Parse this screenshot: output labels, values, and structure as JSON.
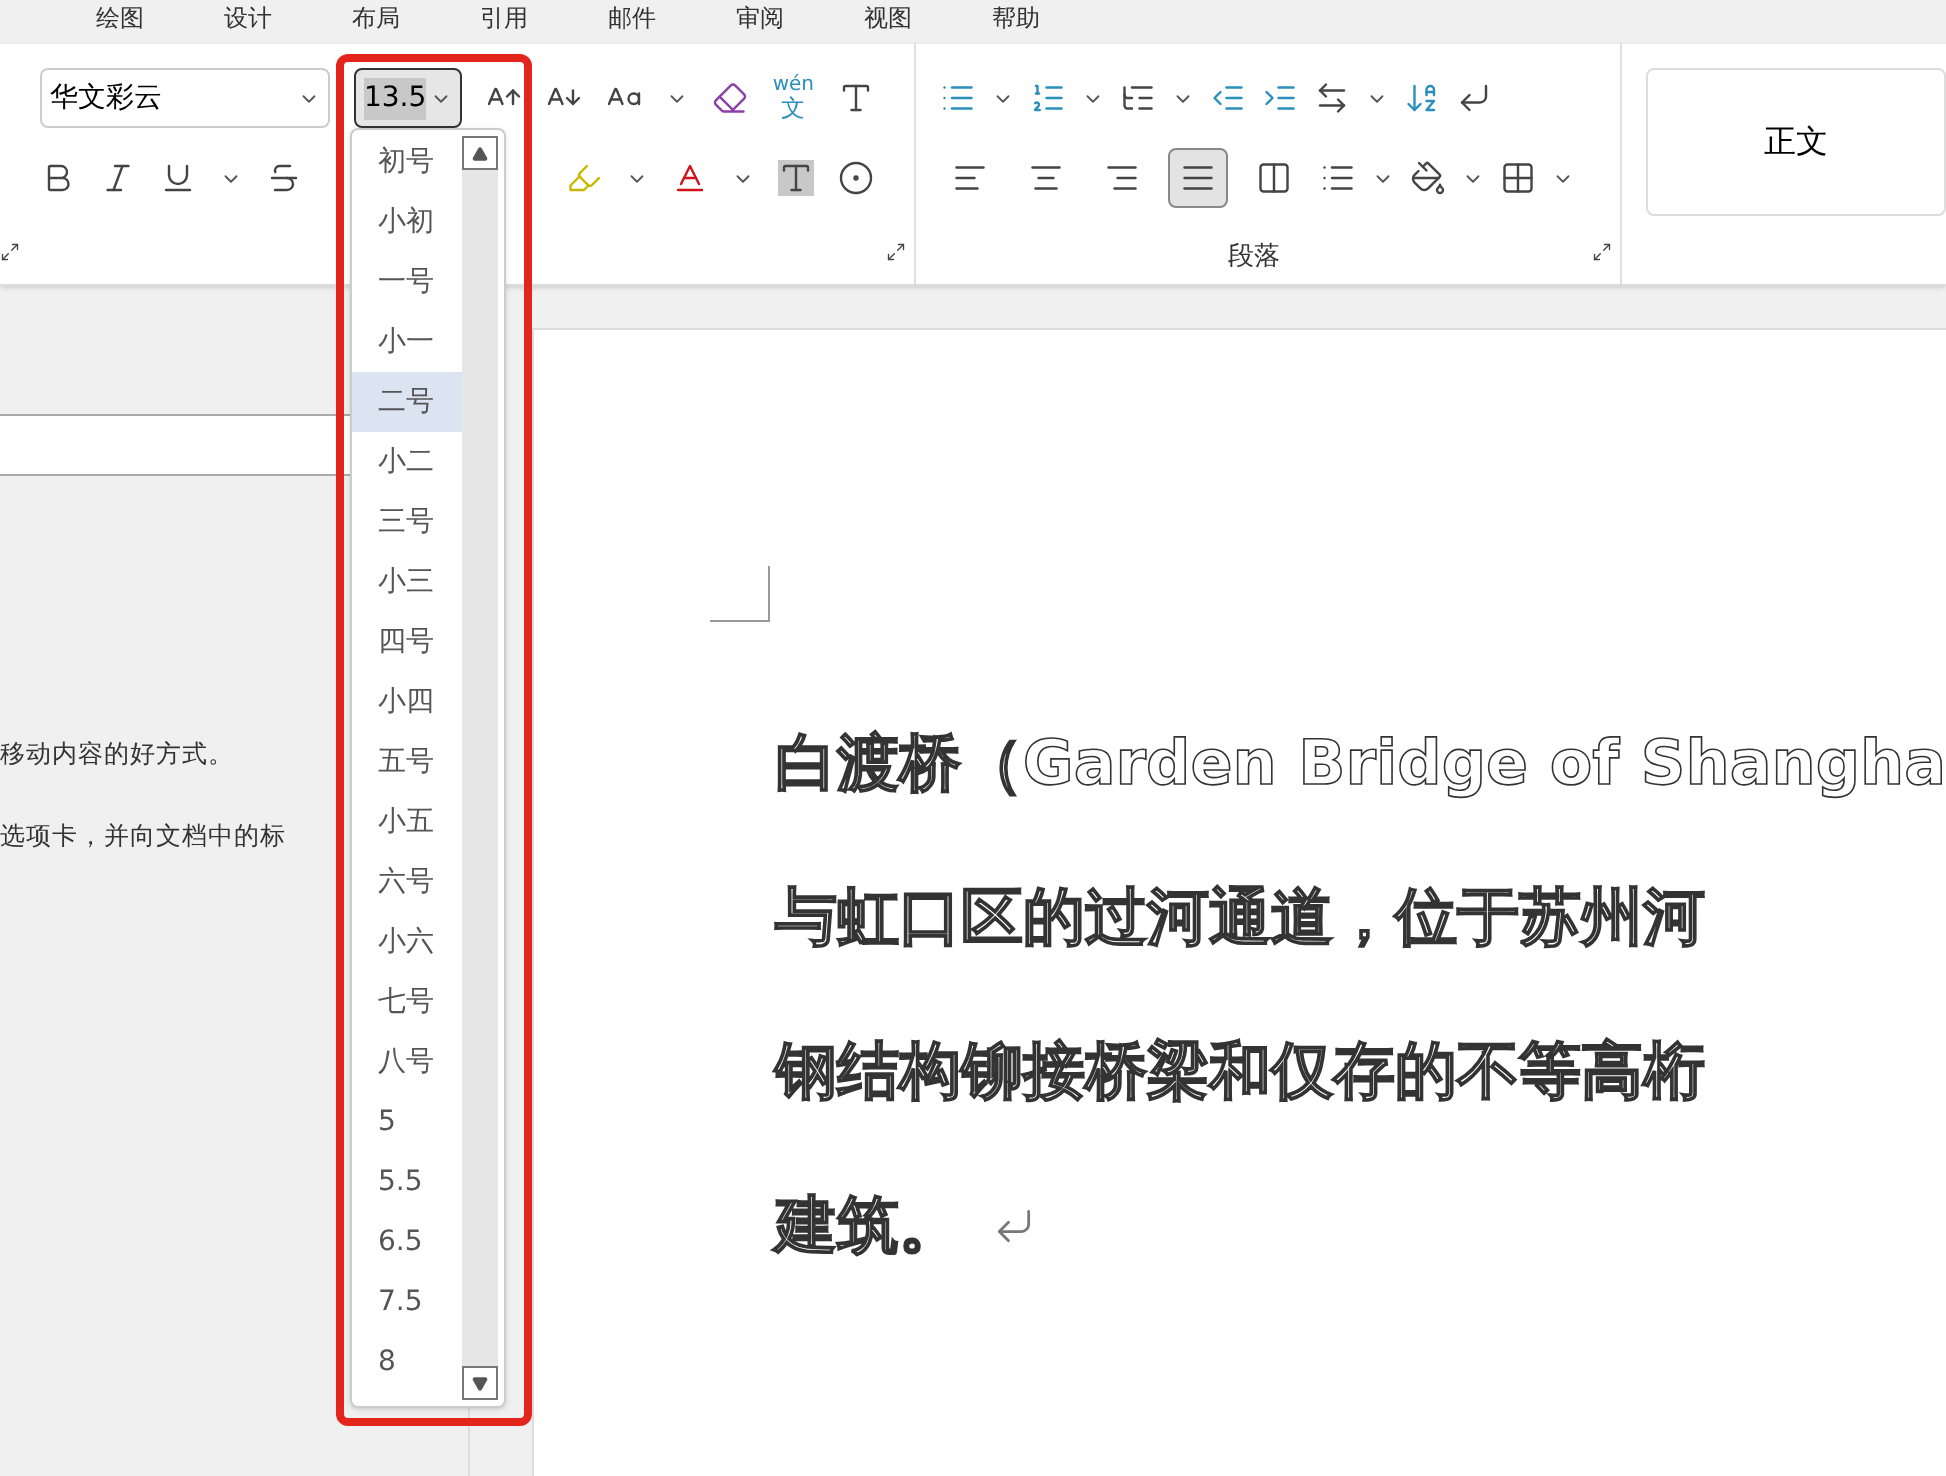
{
  "menu": [
    "绘图",
    "设计",
    "布局",
    "引用",
    "邮件",
    "审阅",
    "视图",
    "帮助"
  ],
  "font": {
    "name": "华文彩云",
    "size": "13.5"
  },
  "phonetic_guide": {
    "top": "wén",
    "bottom": "文"
  },
  "paragraph_group": {
    "label": "段落",
    "alignments": [
      {
        "kind": "left",
        "selected": false
      },
      {
        "kind": "center",
        "selected": false
      },
      {
        "kind": "right",
        "selected": false
      },
      {
        "kind": "justify",
        "selected": true
      },
      {
        "kind": "distributed",
        "selected": false
      }
    ]
  },
  "styles": [
    {
      "label": "正文"
    }
  ],
  "navigation": {
    "lines": [
      "移动内容的好方式。",
      "选项卡，并向文档中的标"
    ]
  },
  "size_dropdown": {
    "items": [
      {
        "label": "初号",
        "selected": false
      },
      {
        "label": "小初",
        "selected": false
      },
      {
        "label": "一号",
        "selected": false
      },
      {
        "label": "小一",
        "selected": false
      },
      {
        "label": "二号",
        "selected": true
      },
      {
        "label": "小二",
        "selected": false
      },
      {
        "label": "三号",
        "selected": false
      },
      {
        "label": "小三",
        "selected": false
      },
      {
        "label": "四号",
        "selected": false
      },
      {
        "label": "小四",
        "selected": false
      },
      {
        "label": "五号",
        "selected": false
      },
      {
        "label": "小五",
        "selected": false
      },
      {
        "label": "六号",
        "selected": false
      },
      {
        "label": "小六",
        "selected": false
      },
      {
        "label": "七号",
        "selected": false
      },
      {
        "label": "八号",
        "selected": false
      },
      {
        "label": "5",
        "selected": false
      },
      {
        "label": "5.5",
        "selected": false
      },
      {
        "label": "6.5",
        "selected": false
      },
      {
        "label": "7.5",
        "selected": false
      },
      {
        "label": "8",
        "selected": false
      }
    ]
  },
  "document": {
    "lines": [
      "白渡桥（Garden Bridge of Shangha",
      "与虹口区的过河通道，位于苏州河",
      "钢结构铆接桥梁和仅存的不等高桁",
      "建筑。"
    ]
  }
}
